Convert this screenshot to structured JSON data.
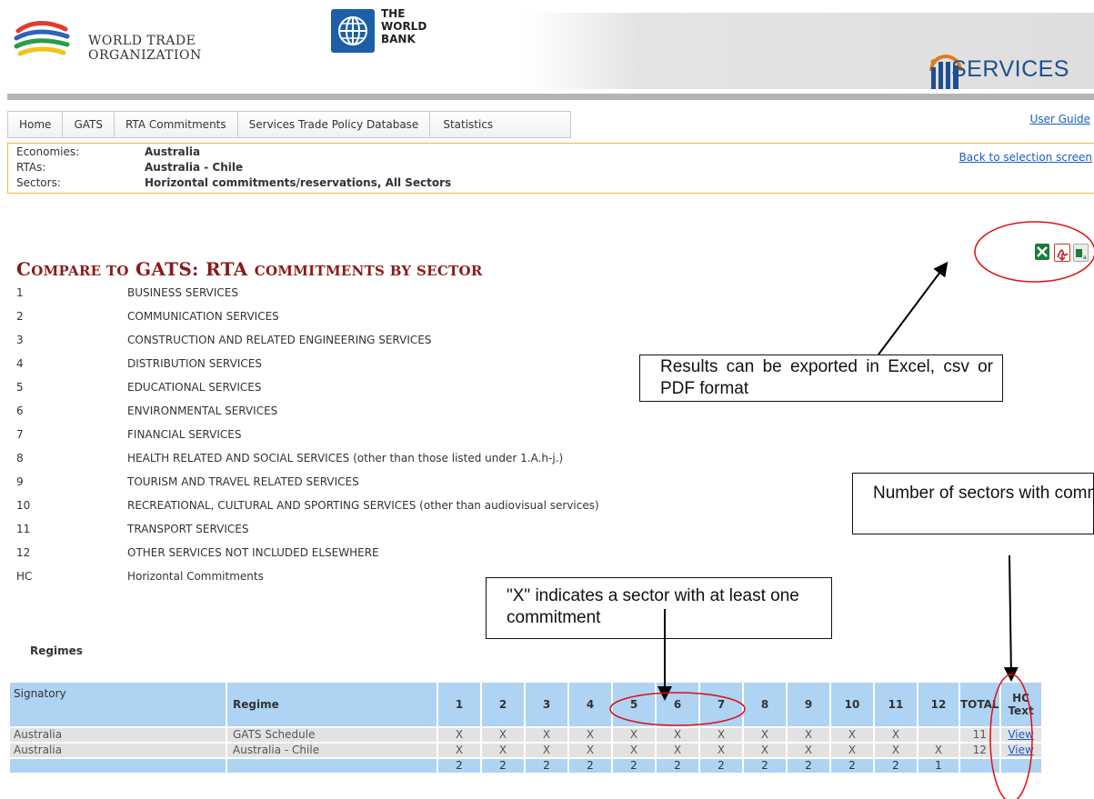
{
  "header": {
    "wto_line1": "WORLD TRADE",
    "wto_line2": "ORGANIZATION",
    "wb_line1": "THE",
    "wb_line2": "WORLD",
    "wb_line3": "BANK",
    "itip_label": "SERVICES"
  },
  "nav": {
    "items": [
      "Home",
      "GATS",
      "RTA Commitments",
      "Services Trade Policy Database",
      "Statistics"
    ],
    "user_guide": "User Guide"
  },
  "selection": {
    "rows": [
      {
        "key": "Economies:",
        "value": "Australia"
      },
      {
        "key": "RTAs:",
        "value": "Australia - Chile"
      },
      {
        "key": "Sectors:",
        "value": "Horizontal commitments/reservations, All Sectors"
      }
    ],
    "back_link": "Back to selection screen"
  },
  "export_icons": [
    "excel-icon",
    "pdf-icon",
    "csv-icon"
  ],
  "title": {
    "first": "C",
    "rest1": "OMPARE TO",
    "gats": " GATS: RTA ",
    "rest2": "COMMITMENTS BY SECTOR"
  },
  "sectors": [
    {
      "num": "1",
      "name": "BUSINESS SERVICES"
    },
    {
      "num": "2",
      "name": "COMMUNICATION SERVICES"
    },
    {
      "num": "3",
      "name": "CONSTRUCTION AND RELATED ENGINEERING SERVICES"
    },
    {
      "num": "4",
      "name": "DISTRIBUTION SERVICES"
    },
    {
      "num": "5",
      "name": "EDUCATIONAL SERVICES"
    },
    {
      "num": "6",
      "name": "ENVIRONMENTAL SERVICES"
    },
    {
      "num": "7",
      "name": "FINANCIAL SERVICES"
    },
    {
      "num": "8",
      "name": "HEALTH RELATED AND SOCIAL SERVICES (other than those listed under 1.A.h-j.)"
    },
    {
      "num": "9",
      "name": "TOURISM AND TRAVEL RELATED SERVICES"
    },
    {
      "num": "10",
      "name": "RECREATIONAL, CULTURAL AND SPORTING SERVICES (other than audiovisual services)"
    },
    {
      "num": "11",
      "name": "TRANSPORT SERVICES"
    },
    {
      "num": "12",
      "name": "OTHER SERVICES NOT INCLUDED ELSEWHERE"
    },
    {
      "num": "HC",
      "name": "Horizontal Commitments"
    }
  ],
  "regimes_label": "Regimes",
  "table": {
    "headers": {
      "signatory": "Signatory",
      "regime": "Regime",
      "cols": [
        "1",
        "2",
        "3",
        "4",
        "5",
        "6",
        "7",
        "8",
        "9",
        "10",
        "11",
        "12"
      ],
      "total": "TOTAL",
      "hc": "HC Text"
    },
    "rows": [
      {
        "signatory": "Australia",
        "regime": "GATS Schedule",
        "cells": [
          "X",
          "X",
          "X",
          "X",
          "X",
          "X",
          "X",
          "X",
          "X",
          "X",
          "X",
          ""
        ],
        "total": "11",
        "hc": "View"
      },
      {
        "signatory": "Australia",
        "regime": "Australia - Chile",
        "cells": [
          "X",
          "X",
          "X",
          "X",
          "X",
          "X",
          "X",
          "X",
          "X",
          "X",
          "X",
          "X"
        ],
        "total": "12",
        "hc": "View"
      }
    ],
    "sum_row": [
      "2",
      "2",
      "2",
      "2",
      "2",
      "2",
      "2",
      "2",
      "2",
      "2",
      "2",
      "1"
    ]
  },
  "annotations": {
    "export": "Results can be exported in Excel, csv or PDF format",
    "x_note": "\"X\" indicates a sector with at least one commitment",
    "number_note": "Number of sectors with commitments"
  },
  "colors": {
    "title": "#8b1a1a",
    "table_header": "#aed3f3",
    "table_row": "#e2e2e2",
    "selection_border": "#f0b83c",
    "annotation_red": "#dd1111",
    "link": "#1a5cc8"
  }
}
